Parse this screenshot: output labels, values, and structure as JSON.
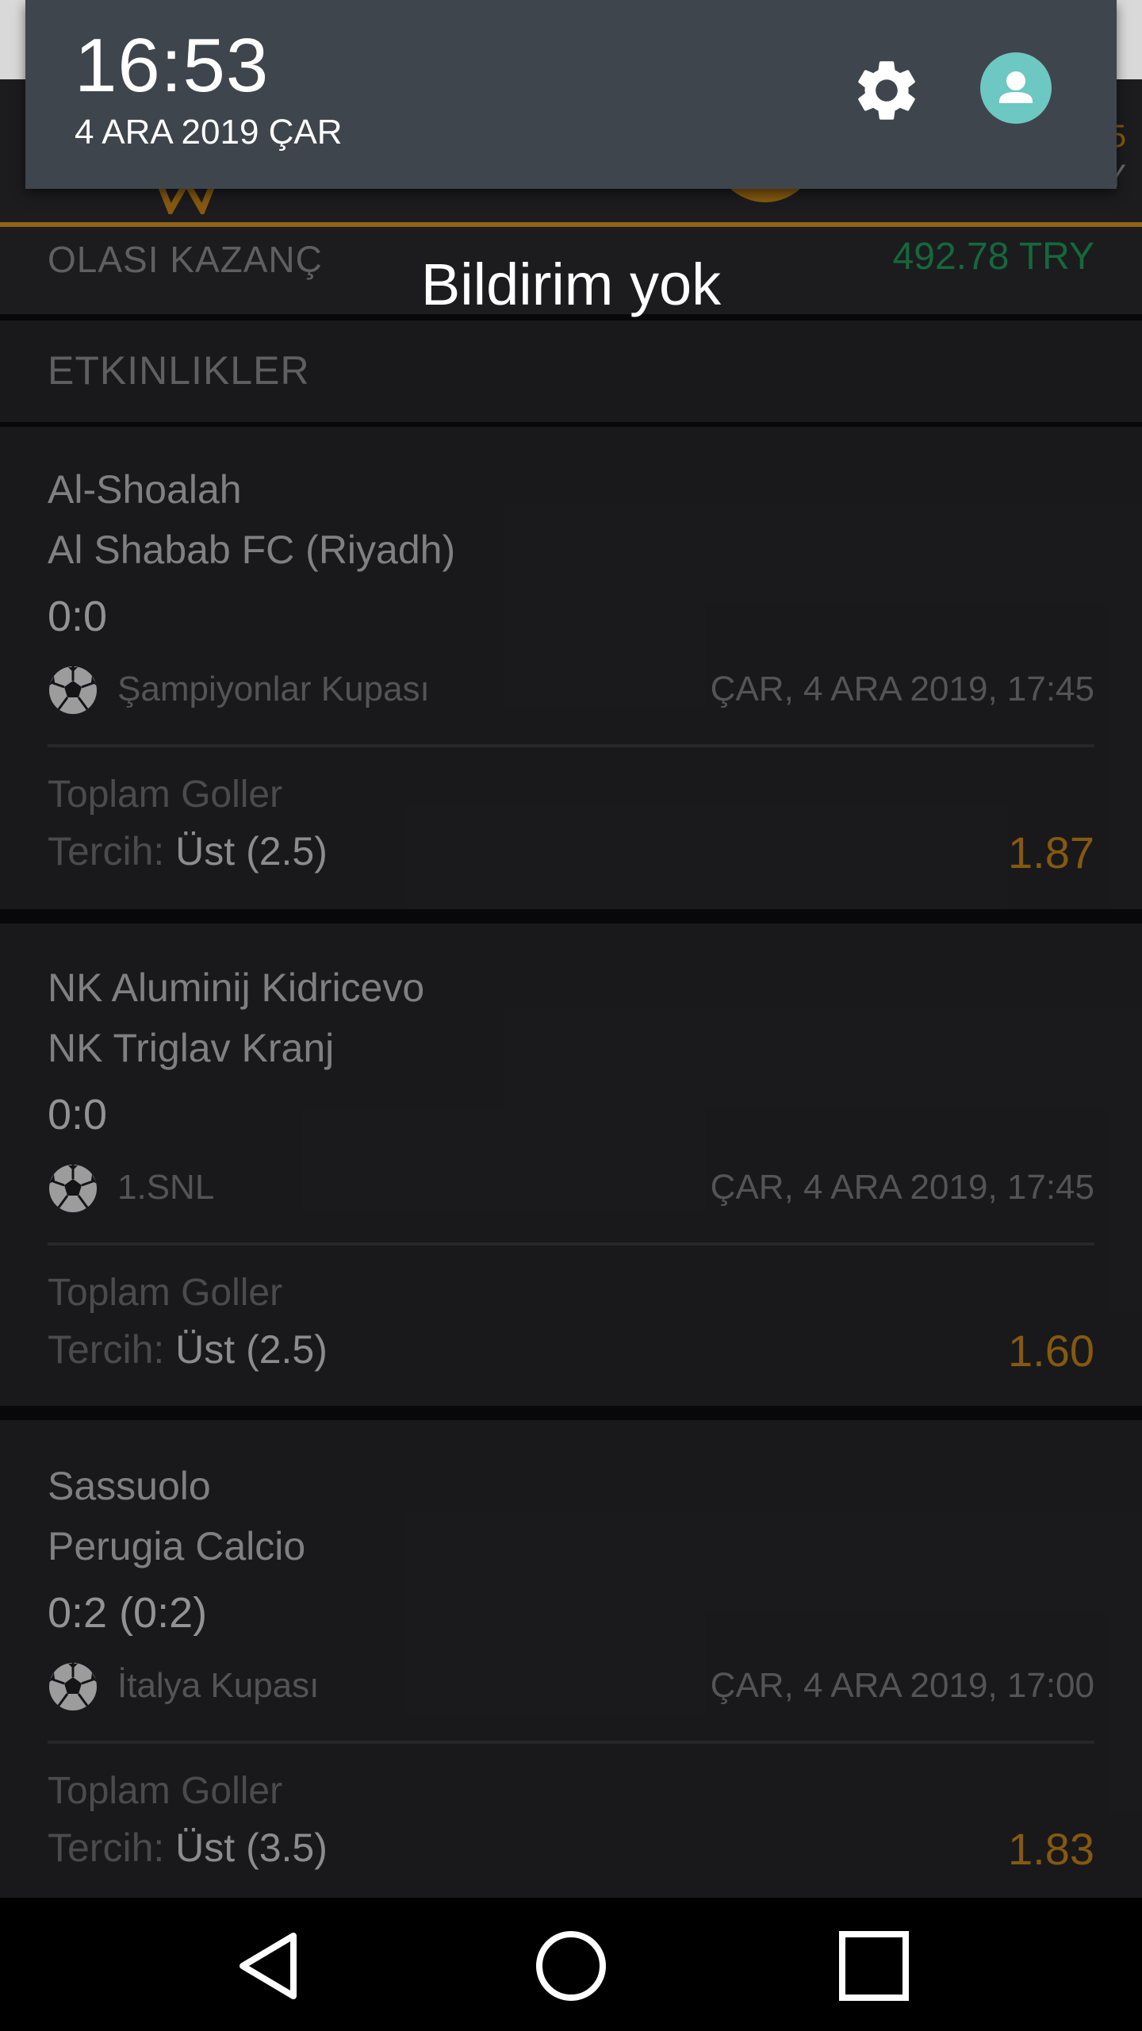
{
  "quick_settings": {
    "time": "16:53",
    "date": "4 ARA 2019 ÇAR",
    "settings_icon": "gear-icon",
    "user_icon": "account-icon"
  },
  "notification_shade": {
    "empty_text": "Bildirim yok"
  },
  "header_peek": {
    "text1": "5",
    "text2": "Y"
  },
  "summary": {
    "potential_win_label": "OLASI KAZANÇ",
    "potential_win_value": "492.78 TRY"
  },
  "events_section": {
    "title": "ETKINLIKLER"
  },
  "events": [
    {
      "home": "Al-Shoalah",
      "away": "Al Shabab FC (Riyadh)",
      "score": "0:0",
      "league": "Şampiyonlar Kupası",
      "datetime": "ÇAR, 4 ARA 2019, 17:45",
      "market": "Toplam Goller",
      "pick_label": "Tercih:",
      "pick_value": "Üst (2.5)",
      "odds": "1.87"
    },
    {
      "home": "NK Aluminij Kidricevo",
      "away": "NK Triglav Kranj",
      "score": "0:0",
      "league": "1.SNL",
      "datetime": "ÇAR, 4 ARA 2019, 17:45",
      "market": "Toplam Goller",
      "pick_label": "Tercih:",
      "pick_value": "Üst (2.5)",
      "odds": "1.60"
    },
    {
      "home": "Sassuolo",
      "away": "Perugia Calcio",
      "score": "0:2 (0:2)",
      "league": "İtalya Kupası",
      "datetime": "ÇAR, 4 ARA 2019, 17:00",
      "market": "Toplam Goller",
      "pick_label": "Tercih:",
      "pick_value": "Üst (3.5)",
      "odds": "1.83"
    }
  ],
  "navbar": {
    "back": "back-icon",
    "home": "home-icon",
    "recents": "recents-icon"
  },
  "colors": {
    "accent": "#d4921f",
    "odds": "#c58417",
    "win": "#1f9a57",
    "panel": "#3f454c",
    "avatar": "#6dc7c2"
  }
}
